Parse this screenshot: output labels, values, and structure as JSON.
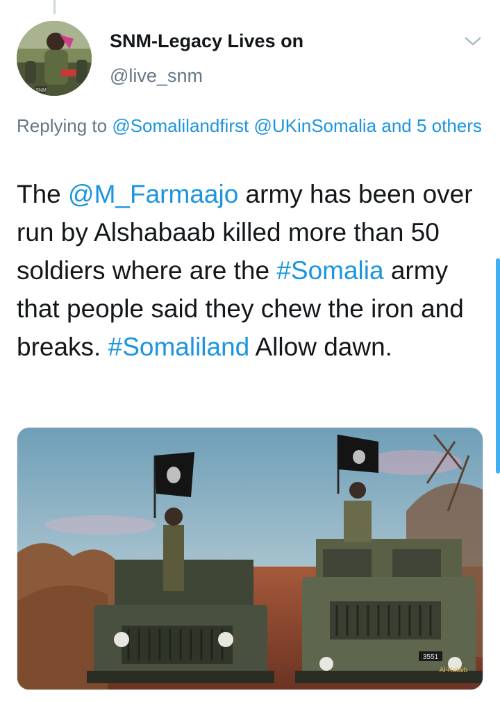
{
  "author": {
    "display_name": "SNM-Legacy Lives on",
    "handle": "@live_snm",
    "avatar_badge": "SNM"
  },
  "reply": {
    "prefix": "Replying to ",
    "mention1": "@Somalilandfirst",
    "mention2": "@UKinSomalia",
    "and_others": "and 5 others"
  },
  "tweet": {
    "text_1": "The ",
    "mention": "@M_Farmaajo",
    "text_2": " army has been over run by Alshabaab killed more than 50 soldiers where are the ",
    "hashtag1": "#Somalia",
    "text_3": " army that people said they chew the iron and breaks. ",
    "hashtag2": "#Somaliland",
    "text_4": " Allow dawn."
  },
  "media": {
    "watermark": "Al-Kataib",
    "plate_text": "3551"
  },
  "icons": {
    "caret": "chevron-down-icon"
  },
  "colors": {
    "link": "#1b95e0",
    "secondary_text": "#657786",
    "primary_text": "#14171a"
  }
}
